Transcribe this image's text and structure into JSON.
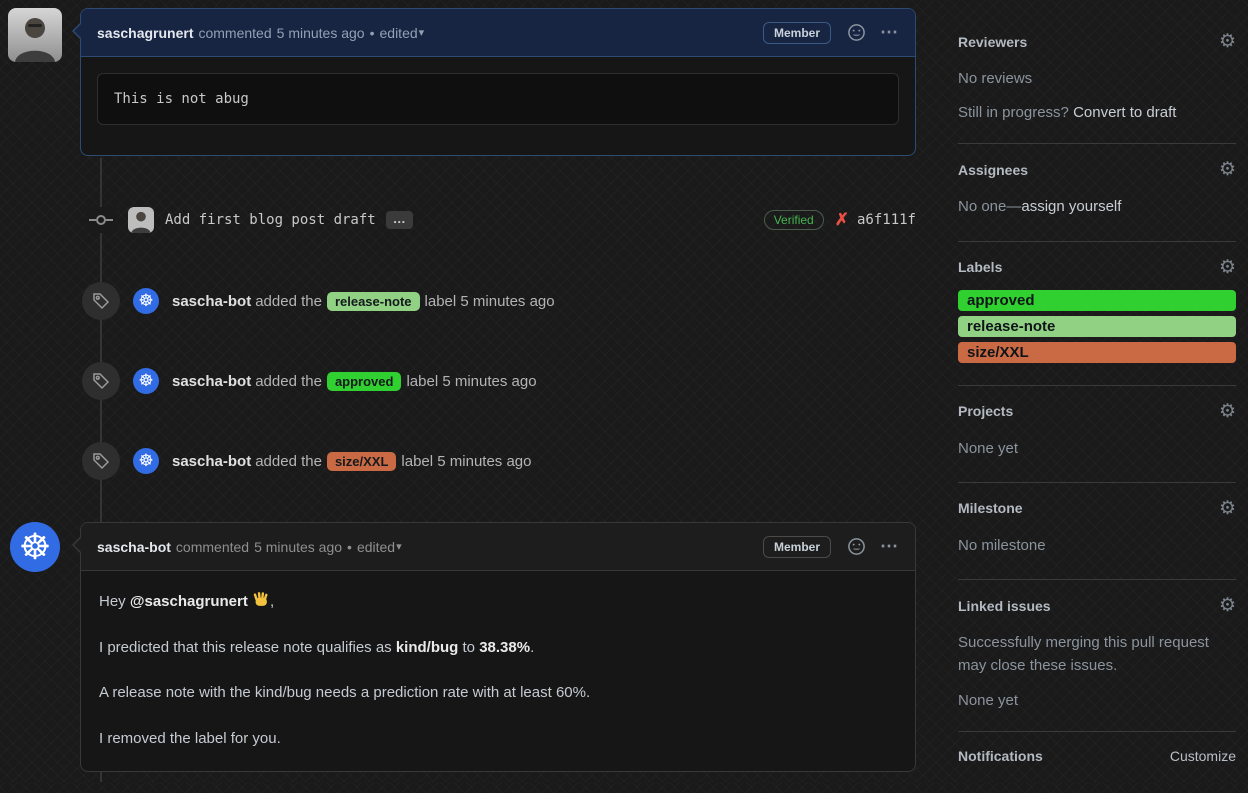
{
  "icons": {
    "gear": "⚙",
    "kebab": "⋯",
    "dropdown_caret": "▾",
    "dot": "•",
    "k8s_wheel": "☸",
    "red_x": "✗",
    "commit_ellipsis": "…"
  },
  "colors": {
    "approved": "#2fd02f",
    "release_note": "#90d183",
    "size_xxl": "#c96a45",
    "k8s_blue": "#326ce5",
    "verified_green": "#46b450",
    "x_red": "#ea4f45",
    "highlight_header": "#172442"
  },
  "comment1": {
    "author": "saschagrunert",
    "action": "commented",
    "time": "5 minutes ago",
    "edited": "edited",
    "member_badge": "Member",
    "code": "This is not abug"
  },
  "commit": {
    "message": "Add first blog post draft",
    "verified_badge": "Verified",
    "hash": "a6f111f"
  },
  "events": [
    {
      "author": "sascha-bot",
      "pre": "added the",
      "label": "release-note",
      "label_color": "#90d183",
      "post": "label 5 minutes ago"
    },
    {
      "author": "sascha-bot",
      "pre": "added the",
      "label": "approved",
      "label_color": "#2fd02f",
      "post": "label 5 minutes ago"
    },
    {
      "author": "sascha-bot",
      "pre": "added the",
      "label": "size/XXL",
      "label_color": "#c96a45",
      "post": "label 5 minutes ago"
    }
  ],
  "comment2": {
    "author": "sascha-bot",
    "action": "commented",
    "time": "5 minutes ago",
    "edited": "edited",
    "member_badge": "Member",
    "p1_pre": "Hey ",
    "p1_mention": "@saschagrunert",
    "p1_post": ",",
    "p2_pre": "I predicted that this release note qualifies as ",
    "p2_bold1": "kind/bug",
    "p2_mid": " to ",
    "p2_bold2": "38.38%",
    "p2_post": ".",
    "p3": "A release note with the kind/bug needs a prediction rate with at least 60%.",
    "p4": "I removed the label for you."
  },
  "sidebar": {
    "reviewers": {
      "title": "Reviewers",
      "empty": "No reviews",
      "hint": "Still in progress? ",
      "link": "Convert to draft"
    },
    "assignees": {
      "title": "Assignees",
      "empty_pre": "No one—",
      "link": "assign yourself"
    },
    "labels": {
      "title": "Labels",
      "items": [
        {
          "name": "approved",
          "color": "#2fd02f"
        },
        {
          "name": "release-note",
          "color": "#90d183"
        },
        {
          "name": "size/XXL",
          "color": "#c96a45"
        }
      ]
    },
    "projects": {
      "title": "Projects",
      "empty": "None yet"
    },
    "milestone": {
      "title": "Milestone",
      "empty": "No milestone"
    },
    "linked_issues": {
      "title": "Linked issues",
      "desc": "Successfully merging this pull request may close these issues.",
      "empty": "None yet"
    },
    "notifications": {
      "title": "Notifications",
      "link": "Customize"
    }
  }
}
